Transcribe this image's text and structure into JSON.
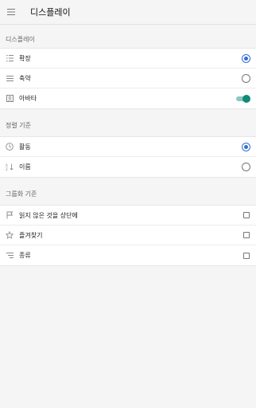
{
  "header": {
    "title": "디스플레이"
  },
  "sections": [
    {
      "title": "디스플레이",
      "items": [
        {
          "label": "확장",
          "icon": "list-expanded-icon",
          "control": "radio",
          "selected": true
        },
        {
          "label": "축약",
          "icon": "list-compact-icon",
          "control": "radio",
          "selected": false
        },
        {
          "label": "아바타",
          "icon": "avatar-icon",
          "control": "toggle",
          "on": true
        }
      ]
    },
    {
      "title": "정렬 기준",
      "items": [
        {
          "label": "활동",
          "icon": "clock-icon",
          "control": "radio",
          "selected": true
        },
        {
          "label": "이름",
          "icon": "sort-alpha-icon",
          "control": "radio",
          "selected": false
        }
      ]
    },
    {
      "title": "그룹화 기준",
      "items": [
        {
          "label": "읽지 않은 것을 상단에",
          "icon": "flag-icon",
          "control": "checkbox",
          "checked": false
        },
        {
          "label": "즐겨찾기",
          "icon": "star-icon",
          "control": "checkbox",
          "checked": false
        },
        {
          "label": "종류",
          "icon": "category-icon",
          "control": "checkbox",
          "checked": false
        }
      ]
    }
  ],
  "colors": {
    "accent_radio": "#2f6fd6",
    "toggle_thumb": "#0f8a78",
    "toggle_track": "#8cc7bf",
    "background": "#f5f5f5"
  }
}
